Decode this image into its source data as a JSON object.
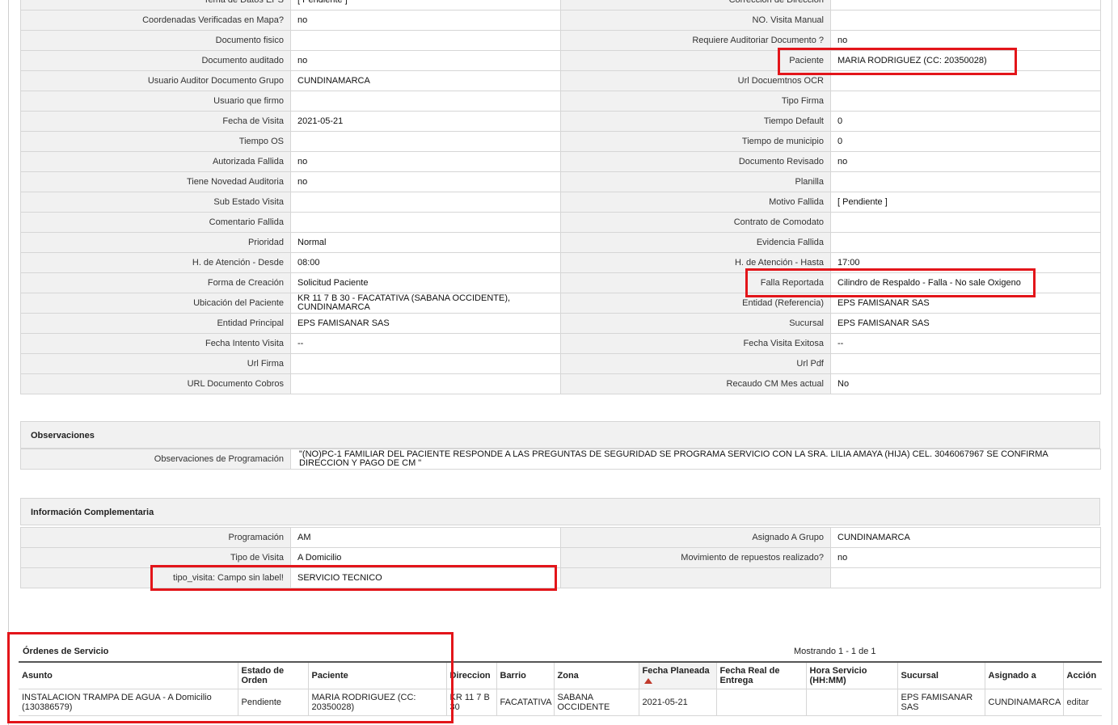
{
  "main_rows": [
    {
      "l1": "Tema de Datos EPS",
      "v1": "[ Pendiente ]",
      "l2": "Corrección de Dirección",
      "v2": ""
    },
    {
      "l1": "Coordenadas Verificadas en Mapa?",
      "v1": "no",
      "l2": "NO. Visita Manual",
      "v2": ""
    },
    {
      "l1": "Documento fisico",
      "v1": "",
      "l2": "Requiere Auditoriar Documento ?",
      "v2": "no"
    },
    {
      "l1": "Documento auditado",
      "v1": "no",
      "l2": "Paciente",
      "v2": "MARIA RODRIGUEZ (CC: 20350028)"
    },
    {
      "l1": "Usuario Auditor Documento Grupo",
      "v1": "CUNDINAMARCA",
      "l2": "Url Docuemtnos OCR",
      "v2": ""
    },
    {
      "l1": "Usuario que firmo",
      "v1": "",
      "l2": "Tipo Firma",
      "v2": ""
    },
    {
      "l1": "Fecha de Visita",
      "v1": "2021-05-21",
      "l2": "Tiempo Default",
      "v2": "0"
    },
    {
      "l1": "Tiempo OS",
      "v1": "",
      "l2": "Tiempo de municipio",
      "v2": "0"
    },
    {
      "l1": "Autorizada Fallida",
      "v1": "no",
      "l2": "Documento Revisado",
      "v2": "no"
    },
    {
      "l1": "Tiene Novedad Auditoria",
      "v1": "no",
      "l2": "Planilla",
      "v2": ""
    },
    {
      "l1": "Sub Estado Visita",
      "v1": "",
      "l2": "Motivo Fallida",
      "v2": "[ Pendiente ]"
    },
    {
      "l1": "Comentario Fallida",
      "v1": "",
      "l2": "Contrato de Comodato",
      "v2": ""
    },
    {
      "l1": "Prioridad",
      "v1": "Normal",
      "l2": "Evidencia Fallida",
      "v2": ""
    },
    {
      "l1": "H. de Atención - Desde",
      "v1": "08:00",
      "l2": "H. de Atención - Hasta",
      "v2": "17:00"
    },
    {
      "l1": "Forma de Creación",
      "v1": "Solicitud Paciente",
      "l2": "Falla Reportada",
      "v2": "Cilindro de Respaldo - Falla - No sale Oxigeno"
    },
    {
      "l1": "Ubicación del Paciente",
      "v1": "KR 11 7 B 30 - FACATATIVA (SABANA OCCIDENTE), CUNDINAMARCA",
      "l2": "Entidad (Referencia)",
      "v2": "EPS FAMISANAR SAS"
    },
    {
      "l1": "Entidad Principal",
      "v1": "EPS FAMISANAR SAS",
      "l2": "Sucursal",
      "v2": "EPS FAMISANAR SAS"
    },
    {
      "l1": "Fecha Intento Visita",
      "v1": "--",
      "l2": "Fecha Visita Exitosa",
      "v2": "--"
    },
    {
      "l1": "Url Firma",
      "v1": "",
      "l2": "Url Pdf",
      "v2": ""
    },
    {
      "l1": "URL Documento Cobros",
      "v1": "",
      "l2": "Recaudo CM Mes actual",
      "v2": "No"
    }
  ],
  "observaciones": {
    "title": "Observaciones",
    "label": "Observaciones de Programación",
    "value": "\"(NO)PC-1 FAMILIAR DEL PACIENTE RESPONDE A LAS PREGUNTAS DE SEGURIDAD SE PROGRAMA SERVICIO CON LA SRA. LILIA AMAYA (HIJA) CEL. 3046067967 SE CONFIRMA DIRECCION Y PAGO DE CM \""
  },
  "complementaria": {
    "title": "Información Complementaria",
    "rows": [
      {
        "l1": "Programación",
        "v1": "AM",
        "l2": "Asignado A Grupo",
        "v2": "CUNDINAMARCA"
      },
      {
        "l1": "Tipo de Visita",
        "v1": "A Domicilio",
        "l2": "Movimiento de repuestos realizado?",
        "v2": "no"
      },
      {
        "l1": "tipo_visita: Campo sin label!",
        "v1": "SERVICIO TECNICO",
        "l2": "",
        "v2": ""
      }
    ]
  },
  "orders": {
    "title": "Órdenes de Servicio",
    "count": "Mostrando 1 - 1 de 1",
    "headers": {
      "asunto": "Asunto",
      "estado": "Estado de Orden",
      "paciente": "Paciente",
      "direccion": "Direccion",
      "barrio": "Barrio",
      "zona": "Zona",
      "fecha_planeada": "Fecha Planeada",
      "fecha_real": "Fecha Real de Entrega",
      "hora": "Hora Servicio (HH:MM)",
      "sucursal": "Sucursal",
      "asignado": "Asignado a",
      "accion": "Acción"
    },
    "rows": [
      {
        "asunto": "INSTALACION TRAMPA DE AGUA - A Domicilio (130386579)",
        "estado": "Pendiente",
        "paciente": "MARIA RODRIGUEZ (CC: 20350028)",
        "direccion": "KR 11 7 B 30",
        "barrio": "FACATATIVA",
        "zona": "SABANA OCCIDENTE",
        "fecha_planeada": "2021-05-21",
        "fecha_real": "",
        "hora": "",
        "sucursal": "EPS FAMISANAR SAS",
        "asignado": "CUNDINAMARCA",
        "accion": "editar"
      }
    ]
  }
}
